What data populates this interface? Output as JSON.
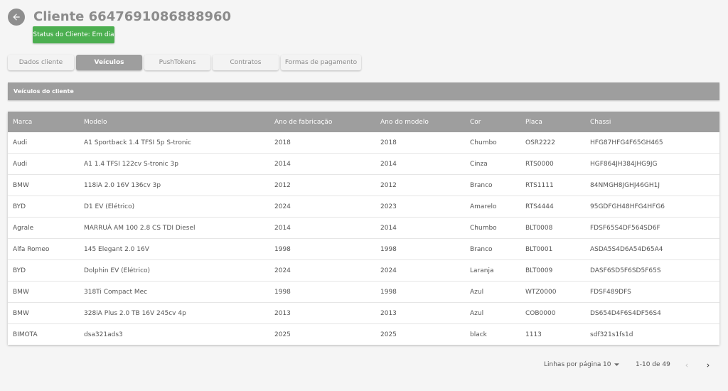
{
  "header": {
    "title": "Cliente 6647691086888960",
    "status_badge": "Status do Cliente: Em dia"
  },
  "tabs": [
    {
      "label": "Dados cliente",
      "active": false
    },
    {
      "label": "Veículos",
      "active": true
    },
    {
      "label": "PushTokens",
      "active": false
    },
    {
      "label": "Contratos",
      "active": false
    },
    {
      "label": "Formas de pagamento",
      "active": false
    }
  ],
  "section": {
    "title": "Veículos do cliente"
  },
  "table": {
    "headers": [
      "Marca",
      "Modelo",
      "Ano de fabricação",
      "Ano do modelo",
      "Cor",
      "Placa",
      "Chassi"
    ],
    "rows": [
      [
        "Audi",
        "A1 Sportback 1.4 TFSI 5p S-tronic",
        "2018",
        "2018",
        "Chumbo",
        "OSR2222",
        "HFG87HFG4F65GH465"
      ],
      [
        "Audi",
        "A1 1.4 TFSI 122cv S-tronic 3p",
        "2014",
        "2014",
        "Cinza",
        "RTS0000",
        "HGF864JH384JHG9JG"
      ],
      [
        "BMW",
        "118iA 2.0 16V 136cv 3p",
        "2012",
        "2012",
        "Branco",
        "RTS1111",
        "84NMGH8JGHJ46GH1J"
      ],
      [
        "BYD",
        "D1 EV (Elétrico)",
        "2024",
        "2023",
        "Amarelo",
        "RTS4444",
        "95GDFGH48HFG4HFG6"
      ],
      [
        "Agrale",
        "MARRUÁ AM 100 2.8 CS TDI Diesel",
        "2014",
        "2014",
        "Chumbo",
        "BLT0008",
        "FDSF65S4DF564SD6F"
      ],
      [
        "Alfa Romeo",
        "145 Elegant 2.0 16V",
        "1998",
        "1998",
        "Branco",
        "BLT0001",
        "ASDA5S4D6A54D65A4"
      ],
      [
        "BYD",
        "Dolphin EV (Elétrico)",
        "2024",
        "2024",
        "Laranja",
        "BLT0009",
        "DASF6SD5F6SD5F65S"
      ],
      [
        "BMW",
        "318Ti Compact Mec",
        "1998",
        "1998",
        "Azul",
        "WTZ0000",
        "FDSF489DFS"
      ],
      [
        "BMW",
        "328iA Plus 2.0 TB 16V 245cv 4p",
        "2013",
        "2013",
        "Azul",
        "COB0000",
        "DS654D4F6S4DF56S4"
      ],
      [
        "BIMOTA",
        "dsa321ads3",
        "2025",
        "2025",
        "black",
        "1113",
        "sdf321s1fs1d"
      ]
    ]
  },
  "pagination": {
    "rows_per_page_label": "Linhas por página",
    "rows_per_page_value": "10",
    "range": "1-10 de 49"
  }
}
